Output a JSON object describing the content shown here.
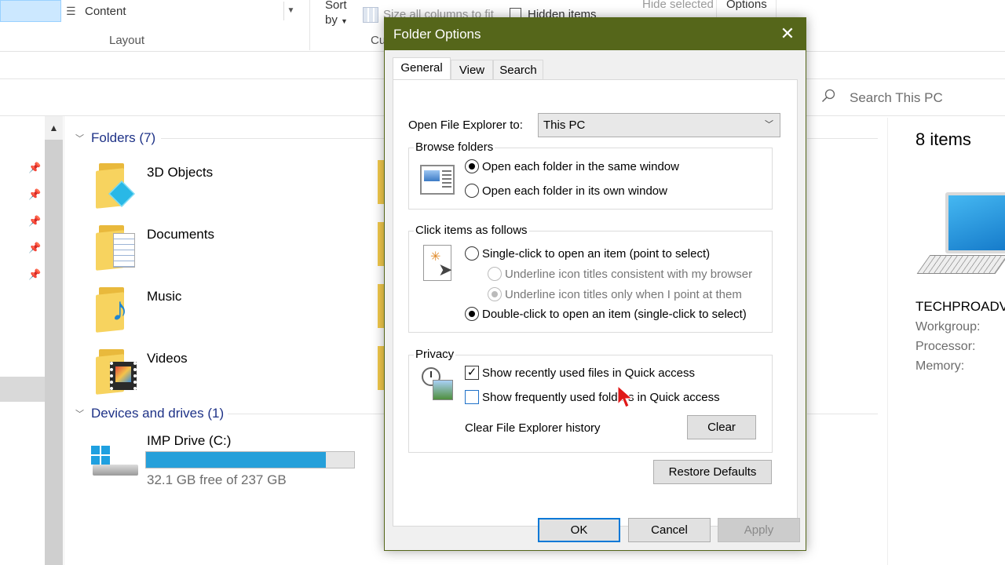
{
  "ribbon": {
    "content_label": "Content",
    "layout_group": "Layout",
    "sort_by_line1": "Sort",
    "sort_by_line2": "by",
    "size_all_columns": "Size all columns to fit",
    "current_view_group": "Cu",
    "hidden_items": "Hidden items",
    "hide_selected": "Hide selected",
    "options": "Options"
  },
  "search": {
    "placeholder": "Search This PC"
  },
  "content": {
    "folders_header": "Folders (7)",
    "folders": [
      {
        "name": "3D Objects"
      },
      {
        "name": "Documents"
      },
      {
        "name": "Music"
      },
      {
        "name": "Videos"
      }
    ],
    "devices_header": "Devices and drives (1)",
    "drive": {
      "name": "IMP Drive (C:)",
      "free_text": "32.1 GB free of 237 GB",
      "used_fraction": 0.865
    }
  },
  "details": {
    "count": "8 items",
    "computer_name": "TECHPROADV",
    "workgroup": "Workgroup:",
    "processor": "Processor:",
    "memory": "Memory:"
  },
  "dialog": {
    "title": "Folder Options",
    "tabs": [
      "General",
      "View",
      "Search"
    ],
    "active_tab": "General",
    "open_to_label": "Open File Explorer to:",
    "open_to_value": "This PC",
    "browse": {
      "title": "Browse folders",
      "option_same": "Open each folder in the same window",
      "option_own": "Open each folder in its own window"
    },
    "click": {
      "title": "Click items as follows",
      "single": "Single-click to open an item (point to select)",
      "underline_browser": "Underline icon titles consistent with my browser",
      "underline_point": "Underline icon titles only when I point at them",
      "double": "Double-click to open an item (single-click to select)"
    },
    "privacy": {
      "title": "Privacy",
      "recent_files": "Show recently used files in Quick access",
      "frequent_folders": "Show frequently used folders in Quick access",
      "clear_history_label": "Clear File Explorer history",
      "clear_button": "Clear"
    },
    "restore_defaults": "Restore Defaults",
    "ok": "OK",
    "cancel": "Cancel",
    "apply": "Apply"
  },
  "colors": {
    "titlebar": "#55661a",
    "accent": "#0078d7",
    "drive_bar": "#26a0da",
    "group_header": "#1e3287"
  }
}
